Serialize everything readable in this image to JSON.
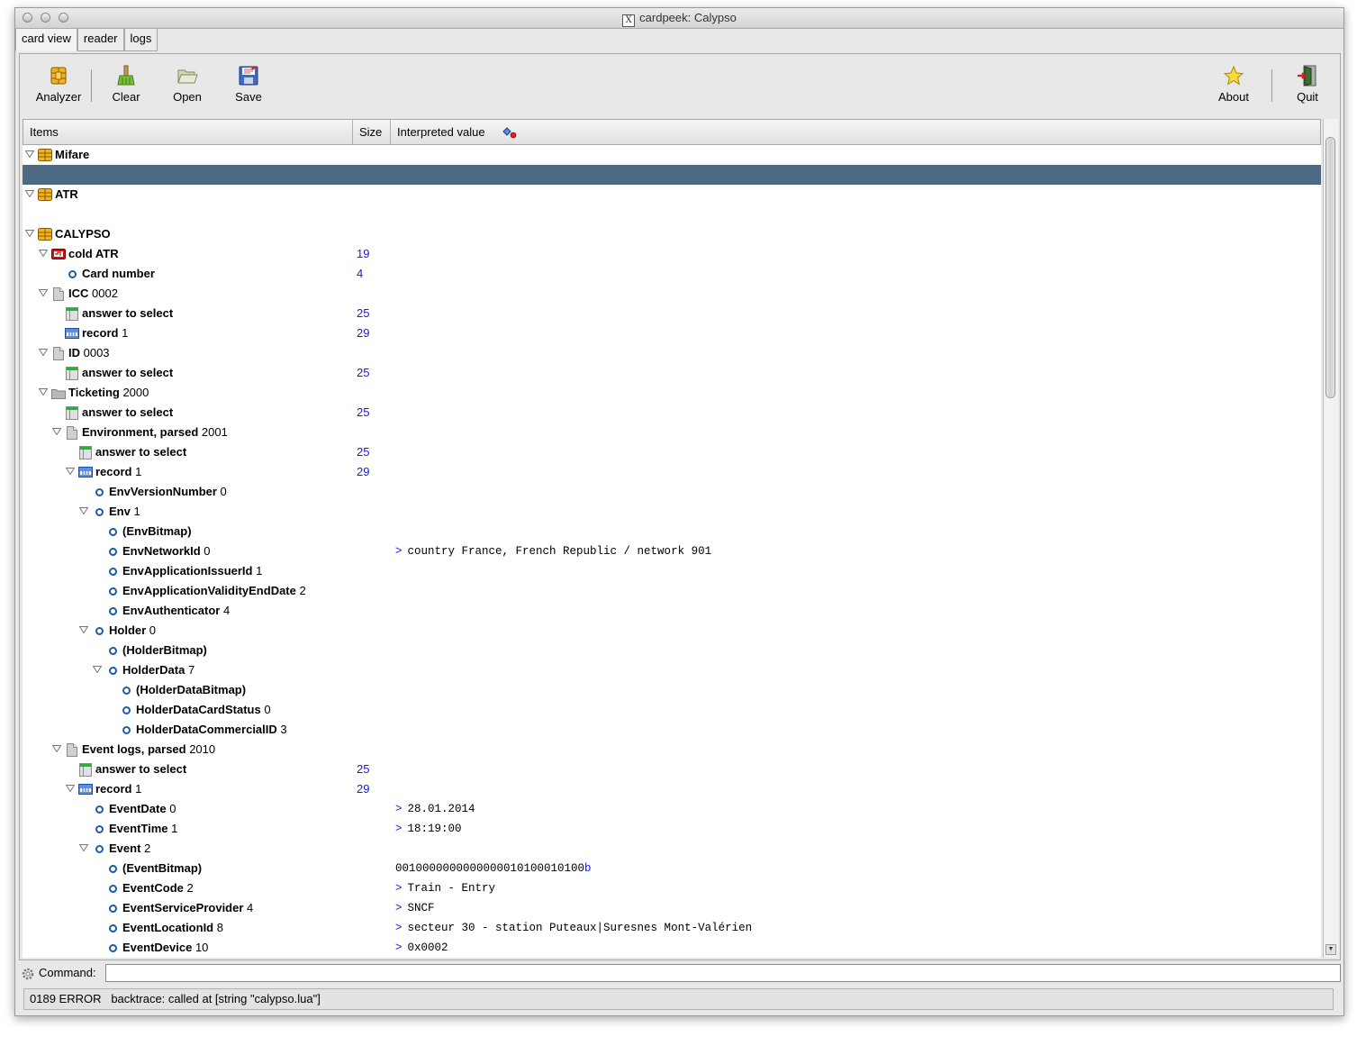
{
  "window": {
    "title": "cardpeek: Calypso"
  },
  "tabs": [
    {
      "label": "card view",
      "active": true
    },
    {
      "label": "reader",
      "active": false
    },
    {
      "label": "logs",
      "active": false
    }
  ],
  "toolbar": {
    "analyzer": "Analyzer",
    "clear": "Clear",
    "open": "Open",
    "save": "Save",
    "about": "About",
    "quit": "Quit"
  },
  "columns": {
    "items": "Items",
    "size": "Size",
    "interpreted": "Interpreted value"
  },
  "tree": [
    {
      "depth": 0,
      "expand": true,
      "icon": "chip",
      "name": "Mifare",
      "id": "",
      "size": "",
      "val": ""
    },
    {
      "depth": 0,
      "expand": false,
      "icon": "none",
      "name": "",
      "id": "",
      "size": "",
      "val": "",
      "selected": true
    },
    {
      "depth": 0,
      "expand": true,
      "icon": "chip",
      "name": "ATR",
      "id": "",
      "size": "",
      "val": ""
    },
    {
      "depth": 0,
      "expand": false,
      "icon": "none",
      "name": "",
      "id": "",
      "size": "",
      "val": ""
    },
    {
      "depth": 0,
      "expand": true,
      "icon": "chip",
      "name": "CALYPSO",
      "id": "",
      "size": "",
      "val": ""
    },
    {
      "depth": 1,
      "expand": true,
      "icon": "atr",
      "name": "cold ATR",
      "id": "",
      "size": "19",
      "val": ""
    },
    {
      "depth": 2,
      "expand": false,
      "icon": "dot",
      "name": "Card number",
      "id": "",
      "size": "4",
      "val": ""
    },
    {
      "depth": 1,
      "expand": true,
      "icon": "file",
      "name": "ICC",
      "id": "0002",
      "size": "",
      "val": ""
    },
    {
      "depth": 2,
      "expand": false,
      "icon": "table",
      "name": "answer to select",
      "id": "",
      "size": "25",
      "val": ""
    },
    {
      "depth": 2,
      "expand": false,
      "icon": "record",
      "name": "record",
      "id": "1",
      "size": "29",
      "val": ""
    },
    {
      "depth": 1,
      "expand": true,
      "icon": "file",
      "name": "ID",
      "id": "0003",
      "size": "",
      "val": ""
    },
    {
      "depth": 2,
      "expand": false,
      "icon": "table",
      "name": "answer to select",
      "id": "",
      "size": "25",
      "val": ""
    },
    {
      "depth": 1,
      "expand": true,
      "icon": "folder",
      "name": "Ticketing",
      "id": "2000",
      "size": "",
      "val": ""
    },
    {
      "depth": 2,
      "expand": false,
      "icon": "table",
      "name": "answer to select",
      "id": "",
      "size": "25",
      "val": ""
    },
    {
      "depth": 2,
      "expand": true,
      "icon": "file",
      "name": "Environment, parsed",
      "id": "2001",
      "size": "",
      "val": ""
    },
    {
      "depth": 3,
      "expand": false,
      "icon": "table",
      "name": "answer to select",
      "id": "",
      "size": "25",
      "val": ""
    },
    {
      "depth": 3,
      "expand": true,
      "icon": "record",
      "name": "record",
      "id": "1",
      "size": "29",
      "val": ""
    },
    {
      "depth": 4,
      "expand": false,
      "icon": "dot",
      "name": "EnvVersionNumber",
      "id": "0",
      "size": "",
      "val": ""
    },
    {
      "depth": 4,
      "expand": true,
      "icon": "dot",
      "name": "Env",
      "id": "1",
      "size": "",
      "val": ""
    },
    {
      "depth": 5,
      "expand": false,
      "icon": "dot",
      "name": "(EnvBitmap)",
      "id": "",
      "size": "",
      "val": ""
    },
    {
      "depth": 5,
      "expand": false,
      "icon": "dot",
      "name": "EnvNetworkId",
      "id": "0",
      "size": "",
      "val": "> country France, French Republic / network 901"
    },
    {
      "depth": 5,
      "expand": false,
      "icon": "dot",
      "name": "EnvApplicationIssuerId",
      "id": "1",
      "size": "",
      "val": ""
    },
    {
      "depth": 5,
      "expand": false,
      "icon": "dot",
      "name": "EnvApplicationValidityEndDate",
      "id": "2",
      "size": "",
      "val": ""
    },
    {
      "depth": 5,
      "expand": false,
      "icon": "dot",
      "name": "EnvAuthenticator",
      "id": "4",
      "size": "",
      "val": ""
    },
    {
      "depth": 4,
      "expand": true,
      "icon": "dot",
      "name": "Holder",
      "id": "0",
      "size": "",
      "val": ""
    },
    {
      "depth": 5,
      "expand": false,
      "icon": "dot",
      "name": "(HolderBitmap)",
      "id": "",
      "size": "",
      "val": ""
    },
    {
      "depth": 5,
      "expand": true,
      "icon": "dot",
      "name": "HolderData",
      "id": "7",
      "size": "",
      "val": ""
    },
    {
      "depth": 6,
      "expand": false,
      "icon": "dot",
      "name": "(HolderDataBitmap)",
      "id": "",
      "size": "",
      "val": ""
    },
    {
      "depth": 6,
      "expand": false,
      "icon": "dot",
      "name": "HolderDataCardStatus",
      "id": "0",
      "size": "",
      "val": ""
    },
    {
      "depth": 6,
      "expand": false,
      "icon": "dot",
      "name": "HolderDataCommercialID",
      "id": "3",
      "size": "",
      "val": ""
    },
    {
      "depth": 2,
      "expand": true,
      "icon": "file",
      "name": "Event logs, parsed",
      "id": "2010",
      "size": "",
      "val": ""
    },
    {
      "depth": 3,
      "expand": false,
      "icon": "table",
      "name": "answer to select",
      "id": "",
      "size": "25",
      "val": ""
    },
    {
      "depth": 3,
      "expand": true,
      "icon": "record",
      "name": "record",
      "id": "1",
      "size": "29",
      "val": ""
    },
    {
      "depth": 4,
      "expand": false,
      "icon": "dot",
      "name": "EventDate",
      "id": "0",
      "size": "",
      "val": "> 28.01.2014"
    },
    {
      "depth": 4,
      "expand": false,
      "icon": "dot",
      "name": "EventTime",
      "id": "1",
      "size": "",
      "val": "> 18:19:00"
    },
    {
      "depth": 4,
      "expand": true,
      "icon": "dot",
      "name": "Event",
      "id": "2",
      "size": "",
      "val": ""
    },
    {
      "depth": 5,
      "expand": false,
      "icon": "dot",
      "name": "(EventBitmap)",
      "id": "",
      "size": "",
      "val": "0010000000000000010100010100b"
    },
    {
      "depth": 5,
      "expand": false,
      "icon": "dot",
      "name": "EventCode",
      "id": "2",
      "size": "",
      "val": "> Train - Entry"
    },
    {
      "depth": 5,
      "expand": false,
      "icon": "dot",
      "name": "EventServiceProvider",
      "id": "4",
      "size": "",
      "val": "> SNCF"
    },
    {
      "depth": 5,
      "expand": false,
      "icon": "dot",
      "name": "EventLocationId",
      "id": "8",
      "size": "",
      "val": "> secteur 30 - station Puteaux|Suresnes Mont-Valérien"
    },
    {
      "depth": 5,
      "expand": false,
      "icon": "dot",
      "name": "EventDevice",
      "id": "10",
      "size": "",
      "val": "> 0x0002"
    }
  ],
  "command": {
    "label": "Command:",
    "value": ""
  },
  "status": {
    "text": "0189 ERROR   backtrace: called at [string \"calypso.lua\"]"
  }
}
